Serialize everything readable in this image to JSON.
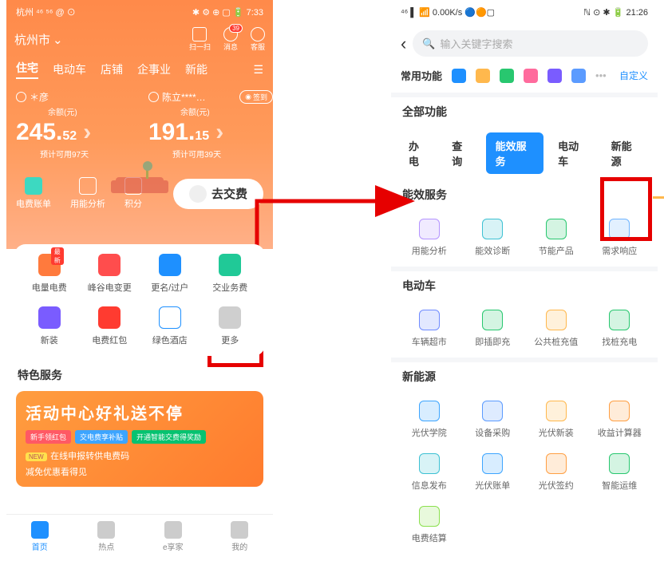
{
  "phone1": {
    "status": {
      "left": "杭州 ⁴⁶ ⁵⁶ @ ⊙",
      "right": "✱ ⚙ ⊕ ▢ 🔋 7:33"
    },
    "city": "杭州市",
    "topicons": {
      "scan": "扫一扫",
      "msg": "消息",
      "msg_badge": "39",
      "support": "客服"
    },
    "tabs": [
      "住宅",
      "电动车",
      "店铺",
      "企事业",
      "新能"
    ],
    "accounts": [
      {
        "name": "＊彦",
        "bal_label": "余额(元)",
        "whole": "245.",
        "cents": "52",
        "est": "预计可用97天"
      },
      {
        "name": "陈立****…",
        "bal_label": "余额(元)",
        "whole": "191.",
        "cents": "15",
        "est": "预计可用39天",
        "goto": "签到"
      }
    ],
    "quick": {
      "bill": "电费账单",
      "use": "用能分析",
      "points": "积分",
      "pay": "去交费"
    },
    "grid": [
      {
        "label": "电量电费",
        "hot": "最新",
        "color": "#ff7a3d"
      },
      {
        "label": "峰谷电变更",
        "color": "#ff4d4d"
      },
      {
        "label": "更名/过户",
        "color": "#1e90ff"
      },
      {
        "label": "交业务费",
        "color": "#20c997"
      },
      {
        "label": "新装",
        "color": "#7a5cff"
      },
      {
        "label": "电费红包",
        "color": "#ff3b30"
      },
      {
        "label": "绿色酒店",
        "color": "#1e90ff"
      },
      {
        "label": "更多",
        "color": "#cfcfcf"
      }
    ],
    "special": "特色服务",
    "banner": {
      "title": "活动中心好礼送不停",
      "pills": [
        "新手领红包",
        "交电费享补贴",
        "开通智能交费得奖励"
      ],
      "new": "NEW",
      "line1": "在线申报转供电费码",
      "line2": "减免优惠看得见"
    },
    "bottom": [
      "首页",
      "热点",
      "e享家",
      "我的"
    ]
  },
  "phone2": {
    "status": {
      "left": "⁴⁶ ▌ 📶 0.00K/s 🔵🟠▢",
      "right": "ℕ ⊙ ✱ 🔋 21:26"
    },
    "search_ph": "输入关键字搜索",
    "common": "常用功能",
    "custom": "自定义",
    "all": "全部功能",
    "tabs": [
      "办电",
      "查询",
      "能效服务",
      "电动车",
      "新能源"
    ],
    "sections": [
      {
        "title": "能效服务",
        "items": [
          {
            "label": "用能分析",
            "c": "#b494ff"
          },
          {
            "label": "能效诊断",
            "c": "#3dc1d3"
          },
          {
            "label": "节能产品",
            "c": "#28c76f"
          },
          {
            "label": "需求响应",
            "c": "#6fb4ff"
          }
        ]
      },
      {
        "title": "电动车",
        "items": [
          {
            "label": "车辆超市",
            "c": "#6f8bff"
          },
          {
            "label": "即插即充",
            "c": "#28c76f"
          },
          {
            "label": "公共桩充值",
            "c": "#ffb84d"
          },
          {
            "label": "找桩充电",
            "c": "#28c76f"
          }
        ]
      },
      {
        "title": "新能源",
        "items": [
          {
            "label": "光伏学院",
            "c": "#3da5ff"
          },
          {
            "label": "设备采购",
            "c": "#5b9bff"
          },
          {
            "label": "光伏新装",
            "c": "#ffb84d"
          },
          {
            "label": "收益计算器",
            "c": "#ff9f43"
          },
          {
            "label": "信息发布",
            "c": "#3dc1d3"
          },
          {
            "label": "光伏账单",
            "c": "#3da5ff"
          },
          {
            "label": "光伏签约",
            "c": "#ff9f43"
          },
          {
            "label": "智能运维",
            "c": "#28c76f"
          },
          {
            "label": "电费结算",
            "c": "#8be04e"
          }
        ]
      }
    ]
  }
}
